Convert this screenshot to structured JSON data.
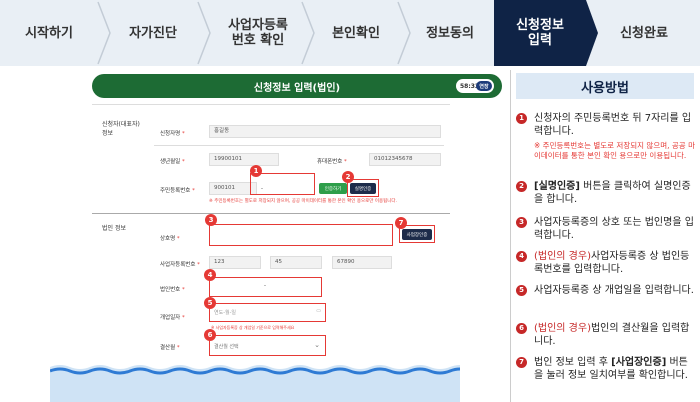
{
  "steps": [
    {
      "label": "시작하기"
    },
    {
      "label": "자가진단"
    },
    {
      "label": "사업자등록\n번호 확인"
    },
    {
      "label": "본인확인"
    },
    {
      "label": "정보동의"
    },
    {
      "label": "신청정보\n입력"
    },
    {
      "label": "신청완료"
    }
  ],
  "form": {
    "header": "신청정보 입력(법인)",
    "timer": "58:33",
    "timer_btn": "연장",
    "applicant_section": "신청자(대표자)\n정보",
    "name_label": "신청자명",
    "name_value": "홍길동",
    "birth_label": "생년월일",
    "birth_value": "19900101",
    "phone_label": "휴대폰번호",
    "phone_value": "01012345678",
    "rrn_label": "주민등록번호",
    "rrn_front": "900101",
    "rrn_sep": "-",
    "verify_btn": "인증하기",
    "realname_btn": "실명인증",
    "rrn_note": "※ 주민등록번호는 별도로 저장되지 않으며, 공공 마이데이터를 통한 본인 확인 용으로만 이용됩니다.",
    "corp_section": "법인 정보",
    "company_label": "상호명",
    "bizcheck_btn": "사업장인증",
    "bizno_label": "사업자등록번호",
    "bizno_1": "123",
    "bizno_2": "45",
    "bizno_3": "67890",
    "corpno_label": "법인번호",
    "corpno_sep": "-",
    "opendate_label": "개업일자",
    "opendate_placeholder": "연도-월-일",
    "opendate_note": "※ 사업자등록증 상 개업일 기준으로 입력해주세요",
    "fiscal_label": "결산월",
    "fiscal_placeholder": "결산월 선택"
  },
  "guide": {
    "title": "사용방법",
    "items": [
      {
        "num": "1",
        "text": "신청자의 주민등록번호 뒤 7자리를 입력합니다.",
        "sub": "※ 주민등록번호는 별도로 저장되지 않으며, 공공 마이데이터를 통한 본인 확인 용으로만 이용됩니다."
      },
      {
        "num": "2",
        "strong": "[실명인증]",
        "text": " 버튼을 클릭하여 실명인증을 합니다."
      },
      {
        "num": "3",
        "text": "사업자등록증의 상호 또는 법인명을 입력합니다."
      },
      {
        "num": "4",
        "red": "(법인의 경우)",
        "text": "사업자등록증 상 법인등록번호를 입력합니다."
      },
      {
        "num": "5",
        "text": "사업자등록증 상 개업일을 입력합니다."
      },
      {
        "num": "6",
        "red": "(법인의 경우)",
        "text": "법인의 결산월을 입력합니다."
      },
      {
        "num": "7",
        "text": "법인 정보 입력 후 ",
        "strong": "[사업장인증]",
        "text2": " 버튼을 눌러 정보 일치여부를 확인합니다."
      }
    ]
  }
}
